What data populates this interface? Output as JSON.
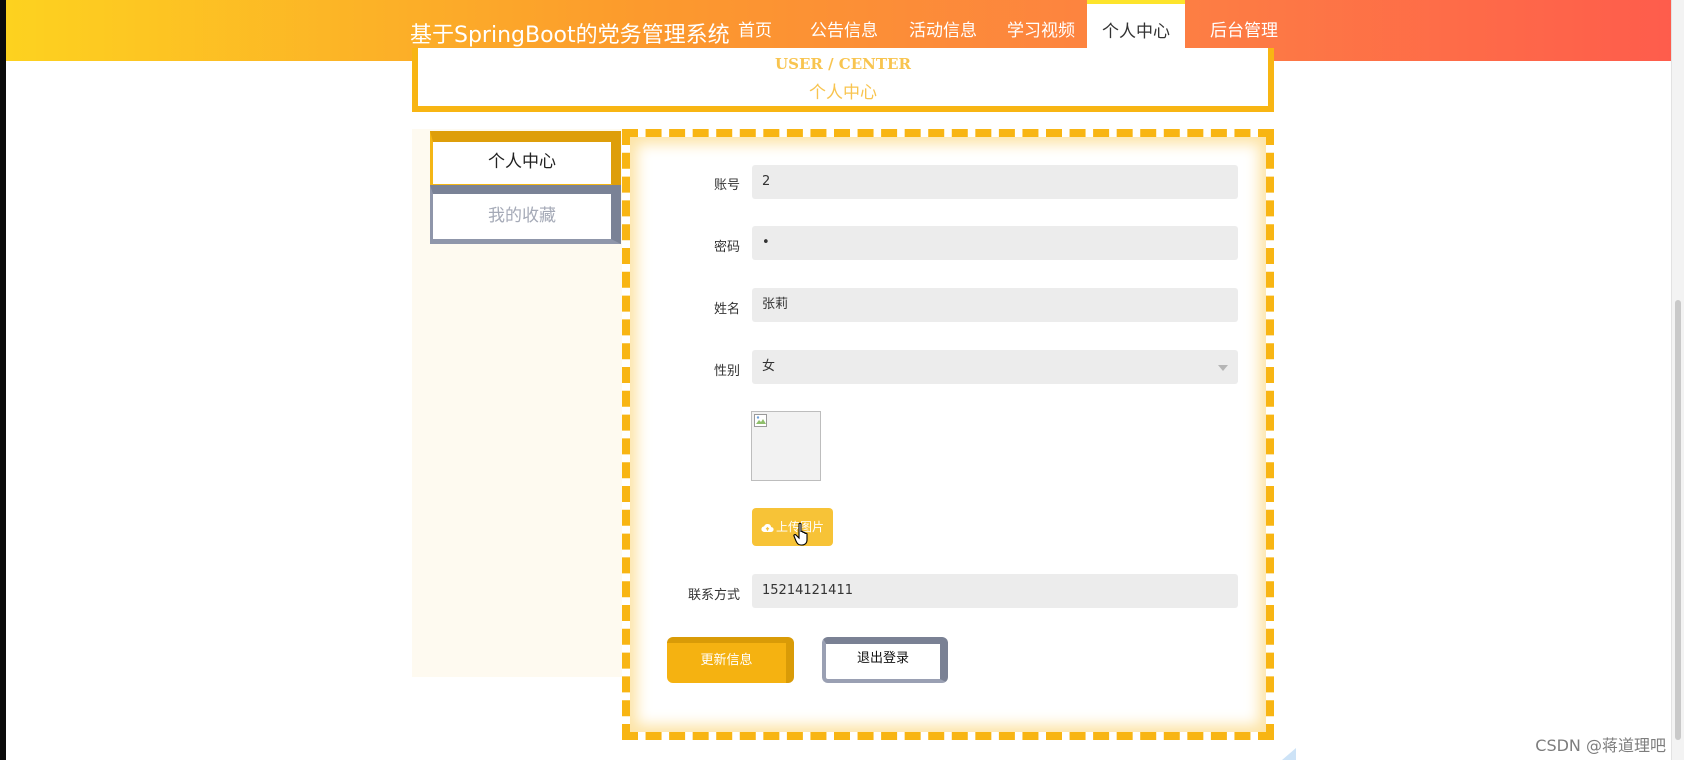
{
  "header": {
    "brand": "基于SpringBoot的党务管理系统",
    "nav": [
      "首页",
      "公告信息",
      "活动信息",
      "学习视频",
      "个人中心",
      "后台管理"
    ],
    "active_nav": "个人中心"
  },
  "title_box": {
    "en": "USER / CENTER",
    "cn": "个人中心"
  },
  "sidebar": {
    "items": [
      "个人中心",
      "我的收藏"
    ],
    "active": "个人中心"
  },
  "form": {
    "account": {
      "label": "账号",
      "value": "2"
    },
    "password": {
      "label": "密码",
      "value": "•"
    },
    "name": {
      "label": "姓名",
      "value": "张莉"
    },
    "gender": {
      "label": "性别",
      "value": "女"
    },
    "upload_label": "上传图片",
    "contact": {
      "label": "联系方式",
      "value": "15214121411"
    }
  },
  "buttons": {
    "update": "更新信息",
    "logout": "退出登录"
  },
  "watermark": "CSDN @蒋道理吧",
  "colors": {
    "accent": "#f8b513",
    "nav_gradient_start": "#fdd21f",
    "nav_gradient_end": "#fe5c4c",
    "muted_border": "#8f96aa"
  }
}
